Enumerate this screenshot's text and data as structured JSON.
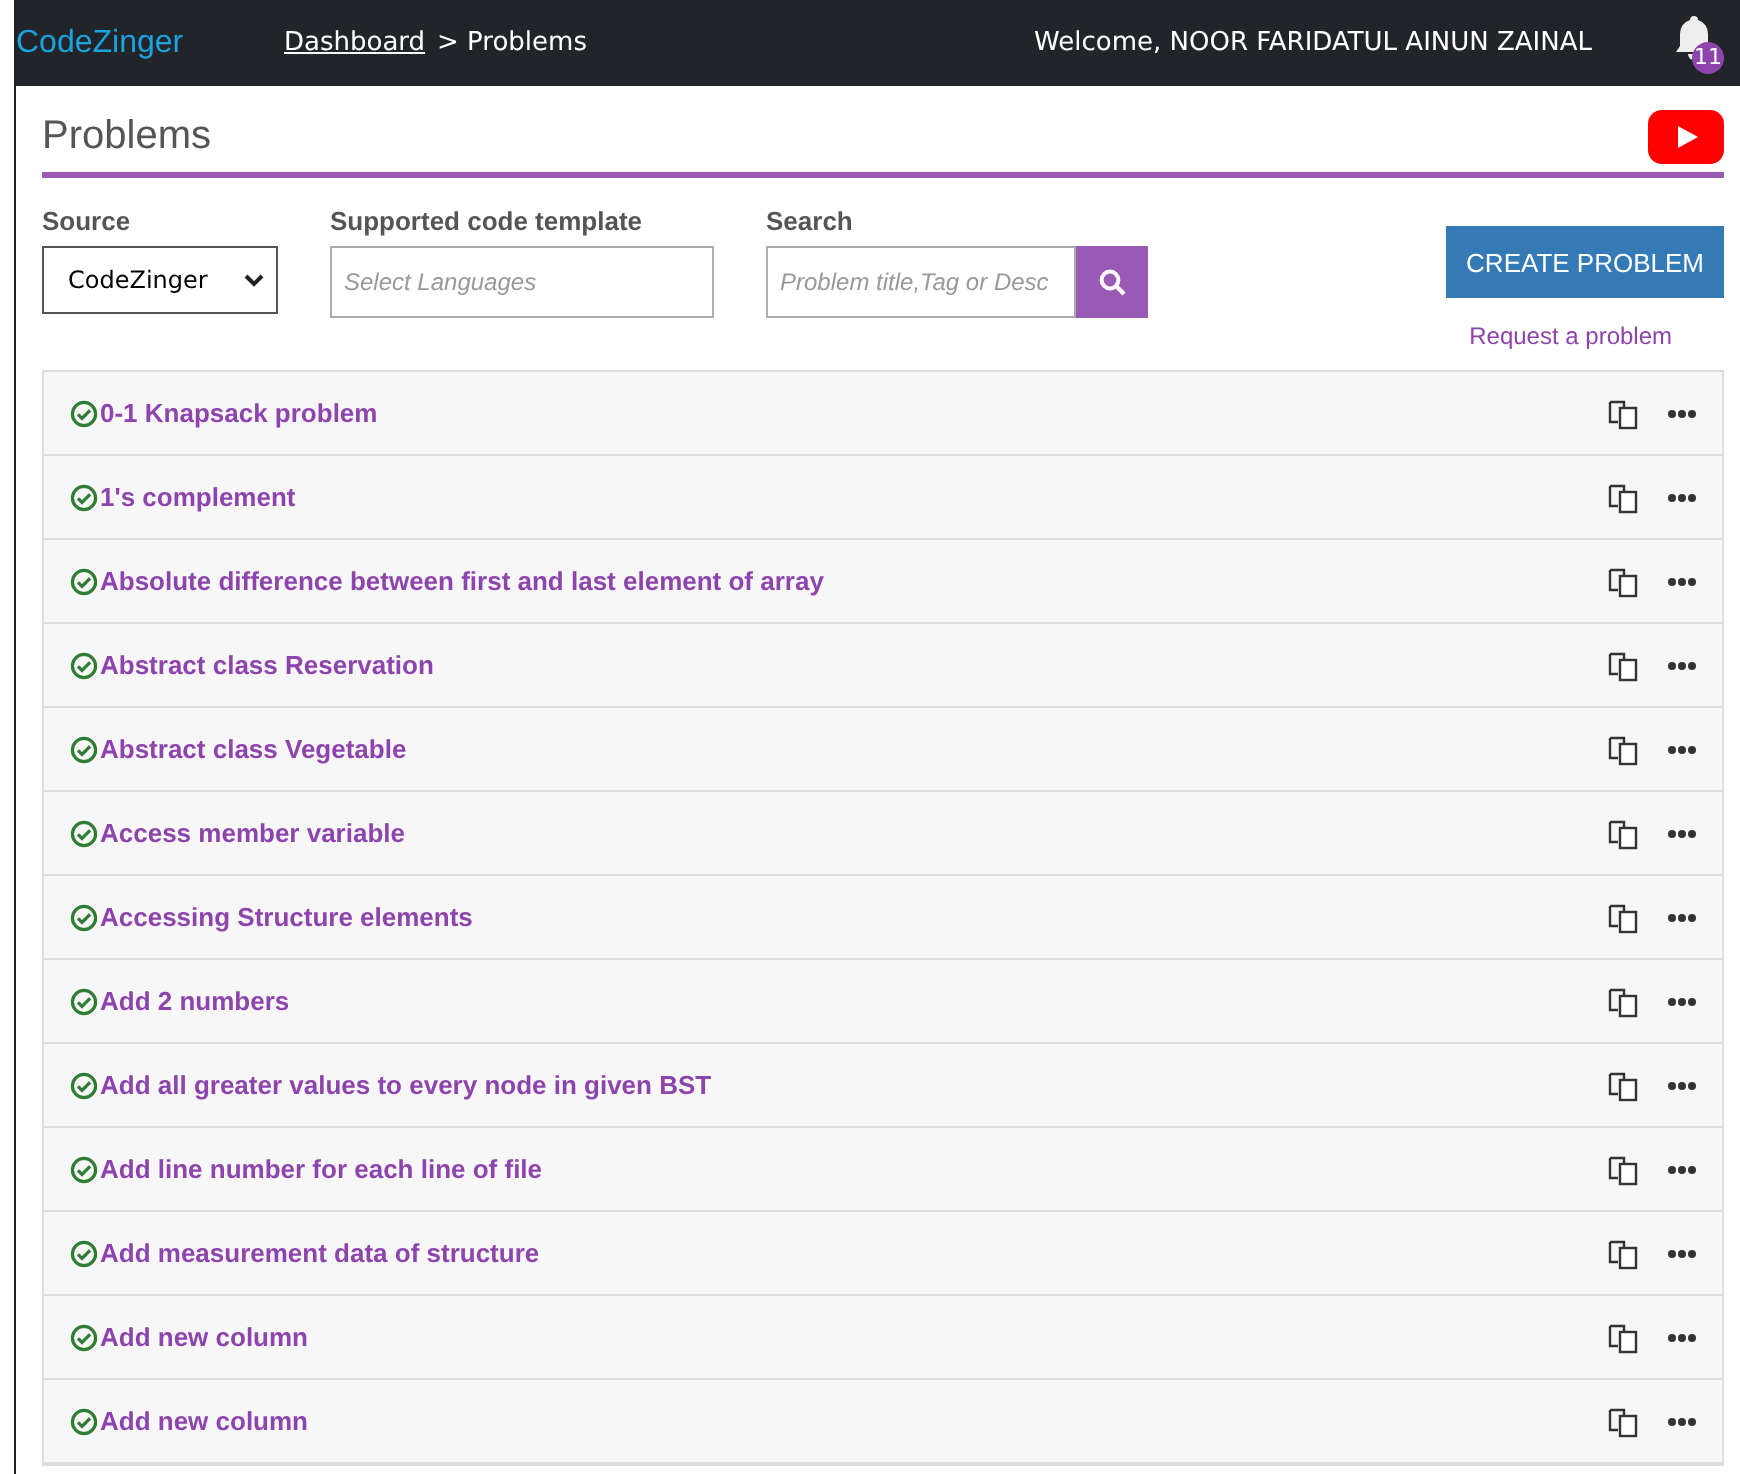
{
  "navbar": {
    "brand": "CodeZinger",
    "breadcrumb": [
      {
        "label": "Dashboard",
        "link": true
      },
      {
        "label": "> Problems",
        "link": false
      }
    ],
    "welcome": "Welcome, NOOR FARIDATUL AINUN ZAINAL",
    "notifications": "11"
  },
  "header": {
    "title": "Problems"
  },
  "filters": {
    "source": {
      "label": "Source",
      "value": "CodeZinger"
    },
    "template": {
      "label": "Supported code template",
      "placeholder": "Select Languages"
    },
    "search": {
      "label": "Search",
      "placeholder": "Problem title,Tag or Desc"
    }
  },
  "create_button": "CREATE PROBLEM",
  "request_link": "Request a problem",
  "problems": [
    {
      "title": "0-1 Knapsack problem"
    },
    {
      "title": "1's complement"
    },
    {
      "title": "Absolute difference between first and last element of array"
    },
    {
      "title": "Abstract class Reservation"
    },
    {
      "title": "Abstract class Vegetable"
    },
    {
      "title": "Access member variable"
    },
    {
      "title": "Accessing Structure elements"
    },
    {
      "title": "Add 2 numbers"
    },
    {
      "title": "Add all greater values to every node in given BST"
    },
    {
      "title": "Add line number for each line of file"
    },
    {
      "title": "Add measurement data of structure"
    },
    {
      "title": "Add new column"
    },
    {
      "title": "Add new column"
    }
  ]
}
